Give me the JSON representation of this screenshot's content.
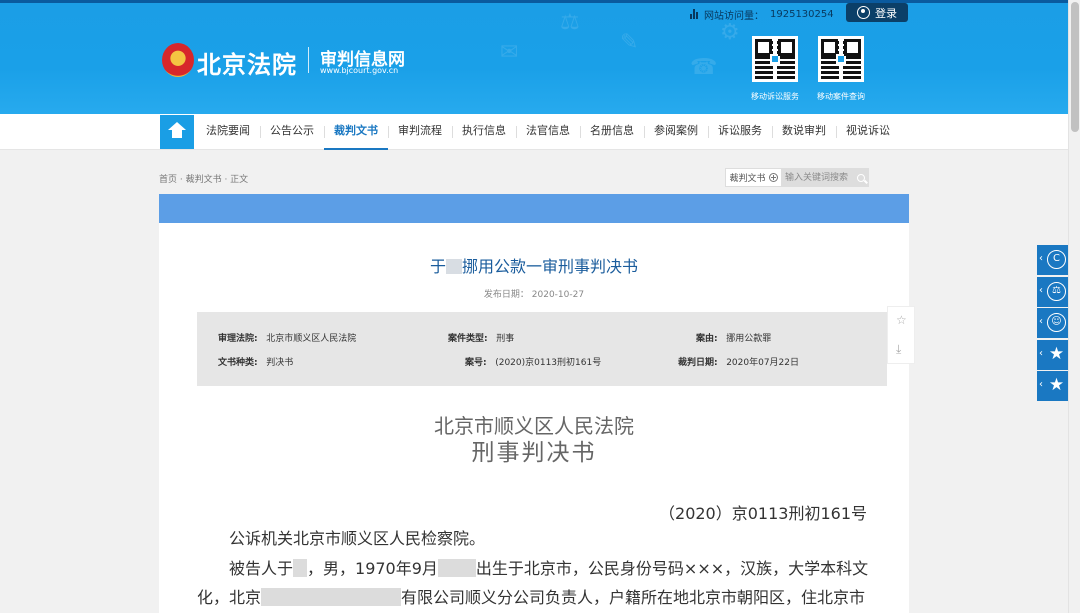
{
  "header": {
    "visits_label": "网站访问量：",
    "visits_count": "1925130254",
    "login_label": "登录",
    "site_name": "北京法院",
    "sub_name": "审判信息网",
    "url": "www.bjcourt.gov.cn",
    "qr_codes": [
      {
        "label": "移动诉讼服务"
      },
      {
        "label": "移动案件查询"
      }
    ]
  },
  "nav": {
    "items": [
      {
        "label": "法院要闻"
      },
      {
        "label": "公告公示"
      },
      {
        "label": "裁判文书",
        "active": true
      },
      {
        "label": "审判流程"
      },
      {
        "label": "执行信息"
      },
      {
        "label": "法官信息"
      },
      {
        "label": "名册信息"
      },
      {
        "label": "参阅案例"
      },
      {
        "label": "诉讼服务"
      },
      {
        "label": "数说审判"
      },
      {
        "label": "视说诉讼"
      }
    ]
  },
  "breadcrumb": "首页 · 裁判文书 · 正文",
  "search": {
    "scope": "裁判文书",
    "placeholder": "输入关键词搜索"
  },
  "document": {
    "title_prefix": "于",
    "title_suffix": "挪用公款一审刑事判决书",
    "publish_date": "发布日期：  2020-10-27",
    "meta": {
      "court_label": "审理法院:",
      "court_value": "北京市顺义区人民法院",
      "case_type_label": "案件类型:",
      "case_type_value": "刑事",
      "cause_label": "案由:",
      "cause_value": "挪用公款罪",
      "doc_type_label": "文书种类:",
      "doc_type_value": "判决书",
      "case_no_label": "案号:",
      "case_no_value": "(2020)京0113刑初161号",
      "judge_date_label": "裁判日期:",
      "judge_date_value": "2020年07月22日"
    },
    "court_name": "北京市顺义区人民法院",
    "doc_kind": "刑事判决书",
    "case_number": "（2020）京0113刑初161号",
    "para1": "公诉机关北京市顺义区人民检察院。",
    "para2_a": "被告人于",
    "para2_b": "，男，1970年9月",
    "para2_c": "出生于北京市，公民身份号码×××，汉族，大学本科文",
    "para3_a": "化，北京",
    "para3_b": "有限公司顺义分公司负责人，户籍所在地北京市朝阳区，住北京市"
  },
  "colors": {
    "header_blue": "#1aa0e8",
    "nav_active": "#1a78c2",
    "band_blue": "#5c9ee6"
  }
}
